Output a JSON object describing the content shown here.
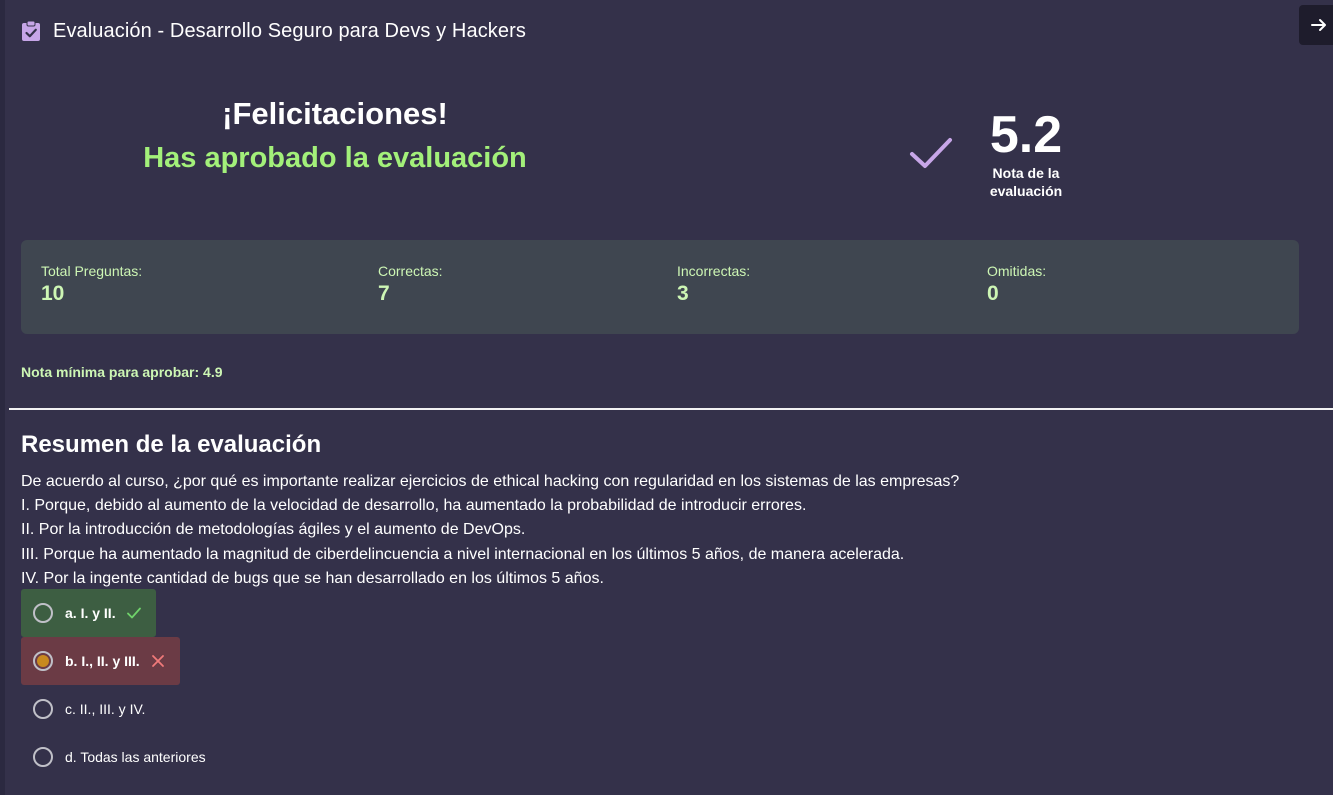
{
  "header": {
    "title": "Evaluación - Desarrollo Seguro para Devs y Hackers"
  },
  "result": {
    "congrats": "¡Felicitaciones!",
    "status": "Has aprobado la evaluación",
    "grade": "5.2",
    "grade_label_1": "Nota de la",
    "grade_label_2": "evaluación"
  },
  "stats": [
    {
      "label": "Total Preguntas:",
      "value": "10"
    },
    {
      "label": "Correctas:",
      "value": "7"
    },
    {
      "label": "Incorrectas:",
      "value": "3"
    },
    {
      "label": "Omitidas:",
      "value": "0"
    }
  ],
  "min_grade": "Nota mínima para aprobar: 4.9",
  "summary": {
    "title": "Resumen de la evaluación",
    "question_lines": [
      "De acuerdo al curso, ¿por qué es importante realizar ejercicios de ethical hacking con regularidad en los sistemas de las empresas?",
      "I. Porque, debido al aumento de la velocidad de desarrollo, ha aumentado la probabilidad de introducir errores.",
      "II. Por la introducción de metodologías ágiles y el aumento de DevOps.",
      "III. Porque ha aumentado la magnitud de ciberdelincuencia a nivel internacional en los últimos 5 años, de manera acelerada.",
      "IV. Por la ingente cantidad de bugs que se han desarrollado en los últimos 5 años."
    ],
    "options": [
      {
        "label": "a. I. y II.",
        "state": "correct"
      },
      {
        "label": "b. I., II. y III.",
        "state": "wrong"
      },
      {
        "label": "c. II., III. y IV.",
        "state": "none"
      },
      {
        "label": "d. Todas las anteriores",
        "state": "none"
      }
    ]
  },
  "colors": {
    "background": "#34314a",
    "accent_green": "#a3f07a",
    "stat_text": "#cdf6b4",
    "correct_bg": "#3d5e42",
    "wrong_bg": "#6b3b45",
    "check_purple": "#c7a6e8"
  },
  "icons": {
    "header": "clipboard-check-icon",
    "exit": "arrow-right-icon",
    "grade": "checkmark-icon",
    "correct": "check-icon",
    "wrong": "x-icon"
  }
}
